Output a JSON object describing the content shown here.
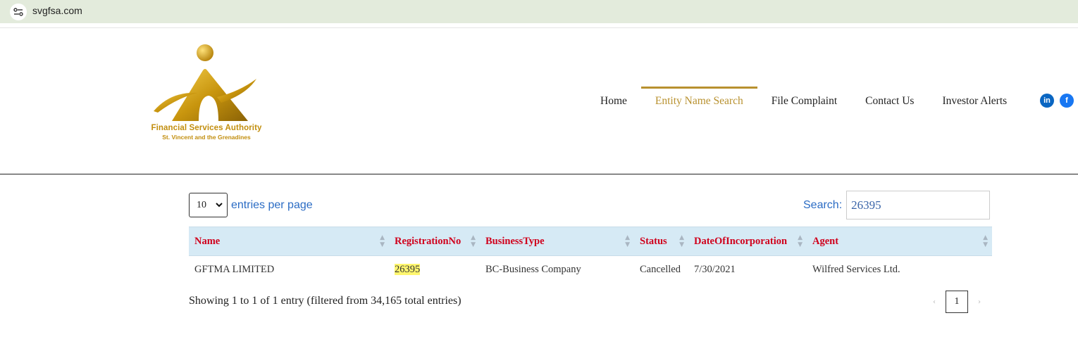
{
  "browser": {
    "url": "svgfsa.com"
  },
  "logo": {
    "line1": "Financial Services Authority",
    "line2": "St. Vincent and the Grenadines",
    "color": "#c28e0e"
  },
  "nav": {
    "items": [
      {
        "label": "Home",
        "active": false
      },
      {
        "label": "Entity Name Search",
        "active": true
      },
      {
        "label": "File Complaint",
        "active": false
      },
      {
        "label": "Contact Us",
        "active": false
      },
      {
        "label": "Investor Alerts",
        "active": false
      }
    ],
    "active_color": "#b8912f",
    "social": [
      {
        "icon": "linkedin-icon",
        "text": "in",
        "color": "#0a66c2"
      },
      {
        "icon": "facebook-icon",
        "text": "f",
        "color": "#1877f2"
      }
    ]
  },
  "controls": {
    "length_value": "10",
    "length_label": "entries per page",
    "search_label": "Search:",
    "search_value": "26395"
  },
  "table": {
    "columns": [
      "Name",
      "RegistrationNo",
      "BusinessType",
      "Status",
      "DateOfIncorporation",
      "Agent"
    ],
    "rows": [
      {
        "name": "GFTMA LIMITED",
        "registration_no": "26395",
        "business_type": "BC-Business Company",
        "status": "Cancelled",
        "date_of_incorporation": "7/30/2021",
        "agent": "Wilfred Services Ltd."
      }
    ],
    "header_color": "#d0001c",
    "header_bg": "#d6eaf5"
  },
  "footer": {
    "info": "Showing 1 to 1 of 1 entry (filtered from 34,165 total entries)",
    "prev": "‹",
    "current_page": "1",
    "next": "›"
  }
}
